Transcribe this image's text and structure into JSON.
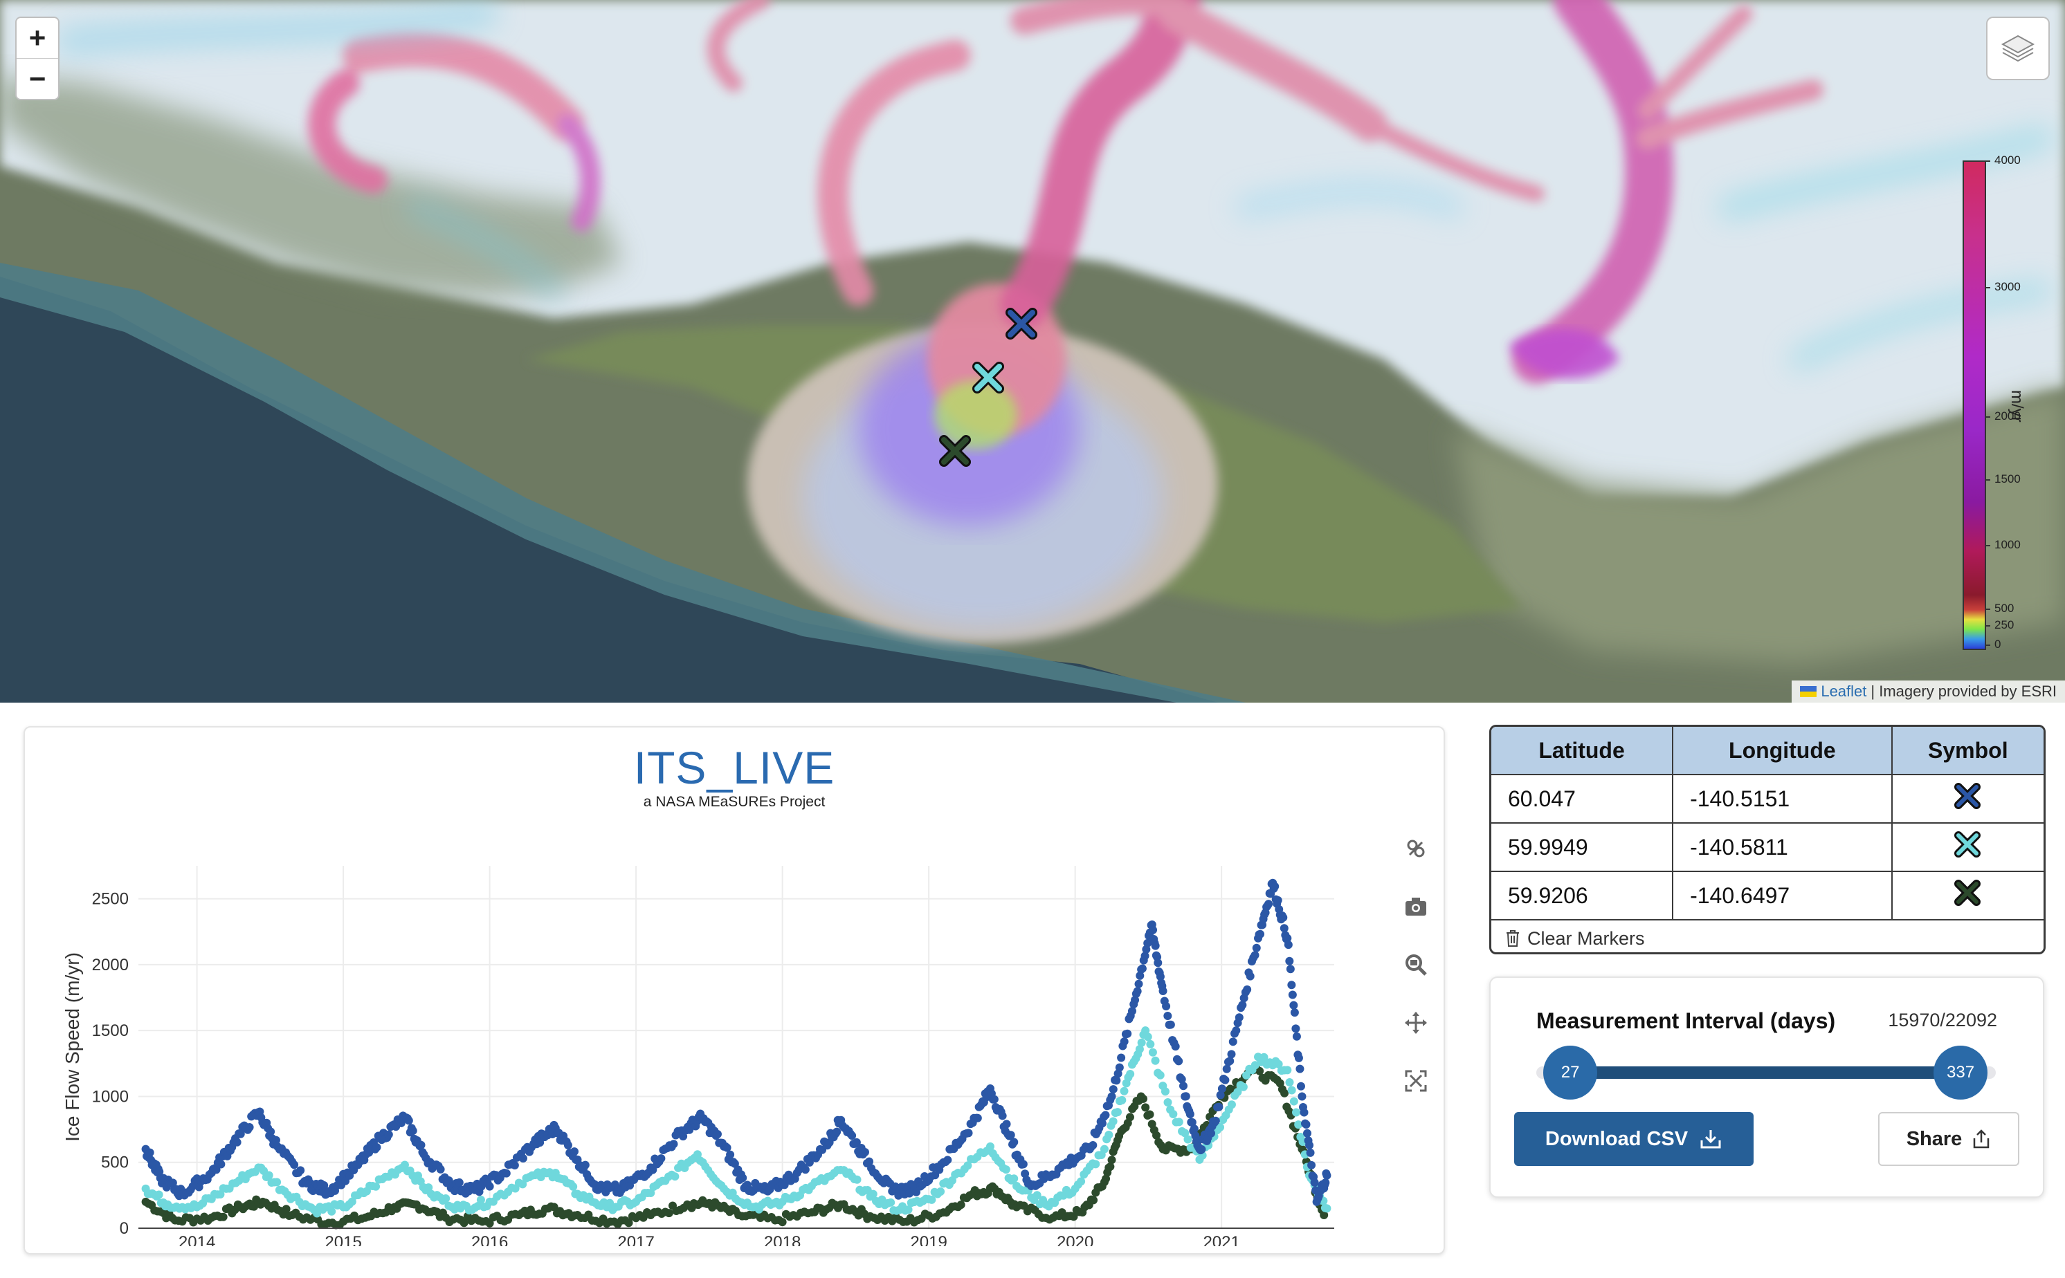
{
  "map": {
    "zoom_in_label": "+",
    "zoom_out_label": "−",
    "layers_icon": "layers-icon",
    "colorbar": {
      "unit": "m/yr",
      "ticks": [
        "4000",
        "3000",
        "2000",
        "1500",
        "1000",
        "500",
        "250",
        "0"
      ]
    },
    "markers": [
      {
        "color": "#2b57a6",
        "name": "blue-x"
      },
      {
        "color": "#6fd8dc",
        "name": "cyan-x"
      },
      {
        "color": "#2c4a2c",
        "name": "green-x"
      }
    ],
    "attribution": {
      "link": "Leaflet",
      "text": "| Imagery provided by ESRI"
    }
  },
  "chart": {
    "logo_title": "ITS_LIVE",
    "logo_subtitle": "a NASA MEaSUREs Project",
    "modebar": [
      "rotate-icon",
      "camera-icon",
      "zoom-icon",
      "pan-icon",
      "autoscale-icon"
    ]
  },
  "chart_data": {
    "type": "scatter",
    "title": "",
    "xlabel": "",
    "ylabel": "Ice Flow Speed (m/yr)",
    "xlim": [
      2013.6,
      2021.77
    ],
    "ylim": [
      0,
      2750
    ],
    "x_ticks": [
      "2014",
      "2015",
      "2016",
      "2017",
      "2018",
      "2019",
      "2020",
      "2021"
    ],
    "y_ticks": [
      "0",
      "500",
      "1000",
      "1500",
      "2000",
      "2500"
    ],
    "grid": true,
    "series": [
      {
        "color": "#2b57a6",
        "points": [
          [
            2013.65,
            600
          ],
          [
            2013.75,
            380
          ],
          [
            2013.9,
            260
          ],
          [
            2014.1,
            420
          ],
          [
            2014.25,
            650
          ],
          [
            2014.42,
            880
          ],
          [
            2014.55,
            620
          ],
          [
            2014.75,
            340
          ],
          [
            2014.9,
            280
          ],
          [
            2015.1,
            480
          ],
          [
            2015.25,
            680
          ],
          [
            2015.42,
            840
          ],
          [
            2015.55,
            560
          ],
          [
            2015.75,
            320
          ],
          [
            2015.9,
            290
          ],
          [
            2016.1,
            420
          ],
          [
            2016.3,
            640
          ],
          [
            2016.45,
            760
          ],
          [
            2016.6,
            520
          ],
          [
            2016.75,
            300
          ],
          [
            2016.9,
            290
          ],
          [
            2017.1,
            460
          ],
          [
            2017.3,
            720
          ],
          [
            2017.45,
            840
          ],
          [
            2017.6,
            620
          ],
          [
            2017.75,
            320
          ],
          [
            2017.9,
            280
          ],
          [
            2018.1,
            420
          ],
          [
            2018.3,
            640
          ],
          [
            2018.4,
            820
          ],
          [
            2018.55,
            560
          ],
          [
            2018.75,
            280
          ],
          [
            2018.9,
            300
          ],
          [
            2019.1,
            500
          ],
          [
            2019.3,
            800
          ],
          [
            2019.42,
            1060
          ],
          [
            2019.55,
            700
          ],
          [
            2019.7,
            320
          ],
          [
            2019.9,
            460
          ],
          [
            2020.1,
            600
          ],
          [
            2020.25,
            1000
          ],
          [
            2020.4,
            1700
          ],
          [
            2020.52,
            2300
          ],
          [
            2020.6,
            1800
          ],
          [
            2020.75,
            1000
          ],
          [
            2020.85,
            600
          ],
          [
            2020.95,
            800
          ],
          [
            2021.1,
            1500
          ],
          [
            2021.25,
            2200
          ],
          [
            2021.35,
            2620
          ],
          [
            2021.45,
            2200
          ],
          [
            2021.55,
            1000
          ],
          [
            2021.65,
            200
          ],
          [
            2021.72,
            400
          ]
        ]
      },
      {
        "color": "#6fd8dc",
        "points": [
          [
            2013.65,
            300
          ],
          [
            2013.8,
            180
          ],
          [
            2014.0,
            160
          ],
          [
            2014.2,
            300
          ],
          [
            2014.42,
            460
          ],
          [
            2014.6,
            280
          ],
          [
            2014.8,
            140
          ],
          [
            2015.0,
            160
          ],
          [
            2015.2,
            320
          ],
          [
            2015.42,
            480
          ],
          [
            2015.6,
            260
          ],
          [
            2015.8,
            150
          ],
          [
            2016.0,
            200
          ],
          [
            2016.25,
            380
          ],
          [
            2016.45,
            420
          ],
          [
            2016.6,
            260
          ],
          [
            2016.8,
            160
          ],
          [
            2017.0,
            200
          ],
          [
            2017.2,
            360
          ],
          [
            2017.42,
            560
          ],
          [
            2017.6,
            300
          ],
          [
            2017.8,
            160
          ],
          [
            2018.0,
            200
          ],
          [
            2018.2,
            320
          ],
          [
            2018.42,
            440
          ],
          [
            2018.6,
            240
          ],
          [
            2018.8,
            140
          ],
          [
            2019.0,
            220
          ],
          [
            2019.2,
            420
          ],
          [
            2019.42,
            620
          ],
          [
            2019.6,
            320
          ],
          [
            2019.8,
            180
          ],
          [
            2020.0,
            300
          ],
          [
            2020.2,
            600
          ],
          [
            2020.35,
            1100
          ],
          [
            2020.48,
            1500
          ],
          [
            2020.65,
            900
          ],
          [
            2020.85,
            520
          ],
          [
            2021.05,
            900
          ],
          [
            2021.25,
            1300
          ],
          [
            2021.45,
            1200
          ],
          [
            2021.6,
            400
          ],
          [
            2021.72,
            150
          ]
        ]
      },
      {
        "color": "#2c4a2c",
        "points": [
          [
            2013.65,
            200
          ],
          [
            2013.85,
            60
          ],
          [
            2014.1,
            80
          ],
          [
            2014.3,
            160
          ],
          [
            2014.45,
            200
          ],
          [
            2014.65,
            100
          ],
          [
            2014.9,
            40
          ],
          [
            2015.15,
            80
          ],
          [
            2015.35,
            160
          ],
          [
            2015.5,
            180
          ],
          [
            2015.7,
            80
          ],
          [
            2015.95,
            50
          ],
          [
            2016.2,
            100
          ],
          [
            2016.4,
            150
          ],
          [
            2016.6,
            100
          ],
          [
            2016.85,
            50
          ],
          [
            2017.1,
            100
          ],
          [
            2017.35,
            180
          ],
          [
            2017.5,
            190
          ],
          [
            2017.7,
            100
          ],
          [
            2017.95,
            60
          ],
          [
            2018.2,
            120
          ],
          [
            2018.4,
            180
          ],
          [
            2018.6,
            90
          ],
          [
            2018.85,
            50
          ],
          [
            2019.1,
            120
          ],
          [
            2019.3,
            260
          ],
          [
            2019.45,
            300
          ],
          [
            2019.6,
            160
          ],
          [
            2019.85,
            80
          ],
          [
            2020.05,
            120
          ],
          [
            2020.2,
            350
          ],
          [
            2020.3,
            700
          ],
          [
            2020.45,
            1000
          ],
          [
            2020.6,
            600
          ],
          [
            2020.8,
            600
          ],
          [
            2021.0,
            1000
          ],
          [
            2021.2,
            1200
          ],
          [
            2021.4,
            1100
          ],
          [
            2021.55,
            600
          ],
          [
            2021.7,
            100
          ]
        ]
      }
    ]
  },
  "table": {
    "headers": [
      "Latitude",
      "Longitude",
      "Symbol"
    ],
    "rows": [
      {
        "lat": "60.047",
        "lon": "-140.5151",
        "symbol_color": "#2b57a6"
      },
      {
        "lat": "59.9949",
        "lon": "-140.5811",
        "symbol_color": "#6fd8dc"
      },
      {
        "lat": "59.9206",
        "lon": "-140.6497",
        "symbol_color": "#2c4a2c"
      }
    ],
    "clear_label": "Clear Markers"
  },
  "interval": {
    "title": "Measurement Interval (days)",
    "count": "15970/22092",
    "min_value": "27",
    "max_value": "337",
    "range_min": 0,
    "range_max": 365,
    "download_label": "Download CSV",
    "share_label": "Share"
  }
}
